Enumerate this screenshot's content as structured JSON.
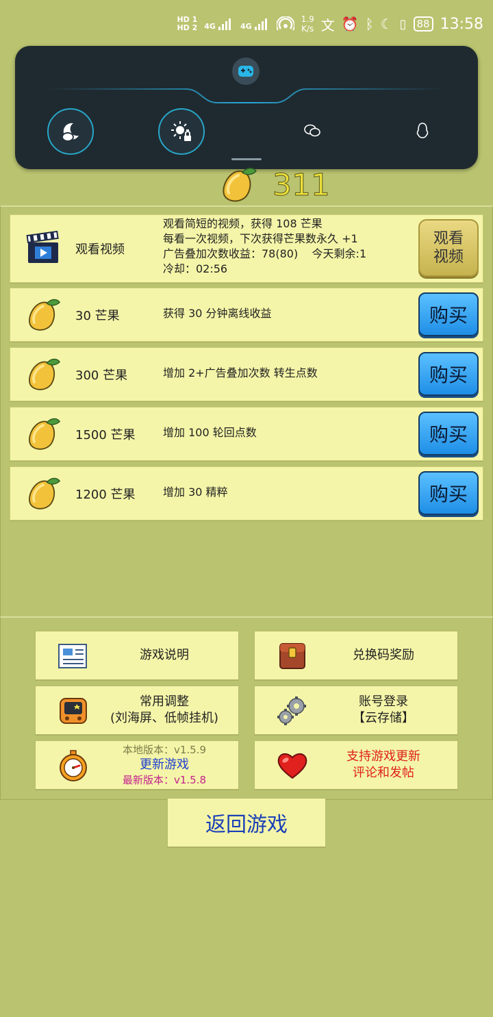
{
  "status_bar": {
    "hd1": "HD 1",
    "hd2": "HD 2",
    "net1": "4G",
    "net2": "4G",
    "speed_value": "1.9",
    "speed_unit": "K/s",
    "battery": "88",
    "time": "13:58"
  },
  "game_panel": {
    "logo_icon": "gamepad-icon",
    "buttons": [
      {
        "icon": "moon-chat-icon"
      },
      {
        "icon": "brightness-lock-icon"
      },
      {
        "icon": "wechat-icon"
      },
      {
        "icon": "qq-icon"
      }
    ]
  },
  "currency": {
    "icon": "mango-icon",
    "value": "311"
  },
  "shop": {
    "video": {
      "title": "观看视频",
      "desc_lines": [
        "观看简短的视频，获得 108 芒果",
        "每看一次视频，下次获得芒果数永久 +1",
        "广告叠加次数收益：78(80)    今天剩余:1",
        "冷却：02:56"
      ],
      "button_lines": [
        "观看",
        "视频"
      ]
    },
    "items": [
      {
        "title": "30 芒果",
        "desc": "获得 30 分钟离线收益",
        "button": "购买"
      },
      {
        "title": "300 芒果",
        "desc": "增加 2+广告叠加次数 转生点数",
        "button": "购买"
      },
      {
        "title": "1500 芒果",
        "desc": "增加 100 轮回点数",
        "button": "购买"
      },
      {
        "title": "1200 芒果",
        "desc": "增加 30 精粹",
        "button": "购买"
      }
    ]
  },
  "menu": {
    "instructions": "游戏说明",
    "redeem": "兑换码奖励",
    "settings_line1": "常用调整",
    "settings_line2": "(刘海屏、低帧挂机)",
    "account_line1": "账号登录",
    "account_line2": "【云存储】",
    "local_version": "本地版本：v1.5.9",
    "update": "更新游戏",
    "latest_version": "最新版本：v1.5.8",
    "support_line1": "支持游戏更新",
    "support_line2": "评论和发帖"
  },
  "back_button": "返回游戏",
  "colors": {
    "background": "#bac36f",
    "row_bg": "#f4f5a8",
    "buy_blue": "#2f9ff0",
    "currency_yellow": "#f1e43b",
    "update_blue": "#1f3fd1",
    "latest_magenta": "#c4228f",
    "support_red": "#e0211d",
    "back_blue": "#1b3fb8"
  }
}
